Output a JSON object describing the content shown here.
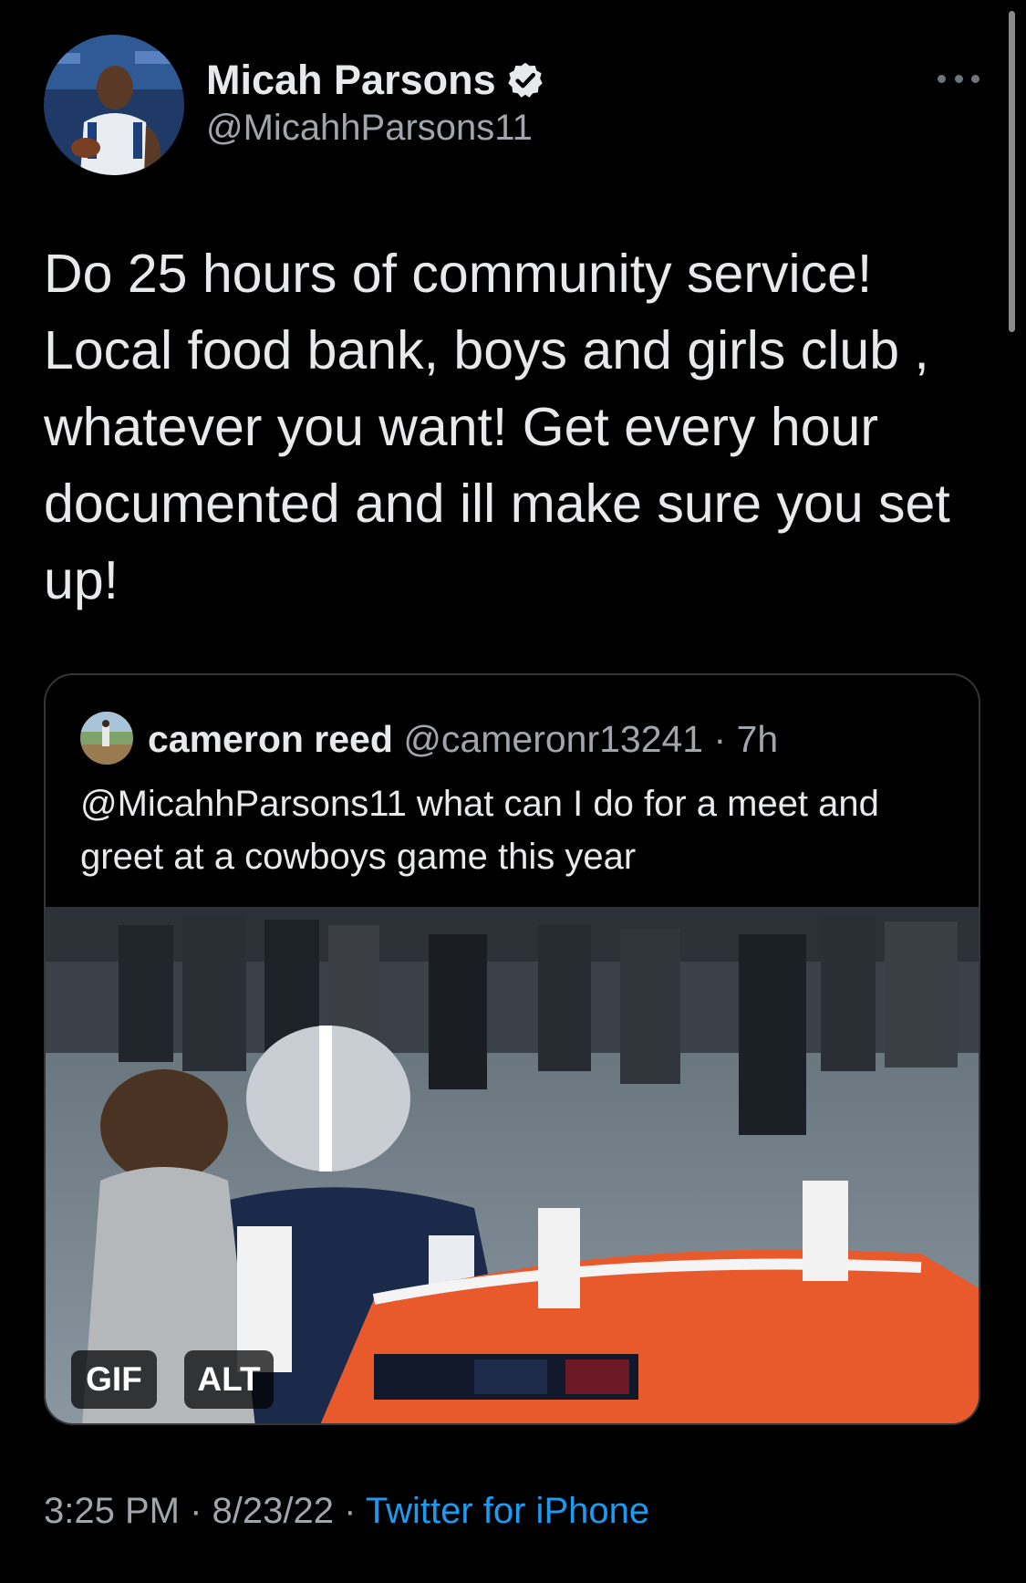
{
  "tweet": {
    "author": {
      "display_name": "Micah Parsons",
      "handle": "@MicahhParsons11",
      "verified": true
    },
    "text": "Do 25 hours of community service! Local food bank, boys and girls club , whatever you  want! Get every hour documented and ill make sure you set up!",
    "timestamp": {
      "time": "3:25 PM",
      "separator": "·",
      "date": "8/23/22",
      "source": "Twitter for iPhone"
    },
    "more_icon": "more-horizontal-icon"
  },
  "quoted_tweet": {
    "display_name": "cameron reed",
    "handle": "@cameronr13241",
    "separator": "·",
    "time": "7h",
    "text": "@MicahhParsons11 what can I do for a meet and greet at a cowboys game this year",
    "media": {
      "badge_gif": "GIF",
      "badge_alt": "ALT"
    }
  },
  "colors": {
    "background": "#000000",
    "text_primary": "#e7e9ea",
    "text_secondary": "#a0a6ab",
    "link": "#1d9bf0",
    "card_border": "#333639"
  }
}
